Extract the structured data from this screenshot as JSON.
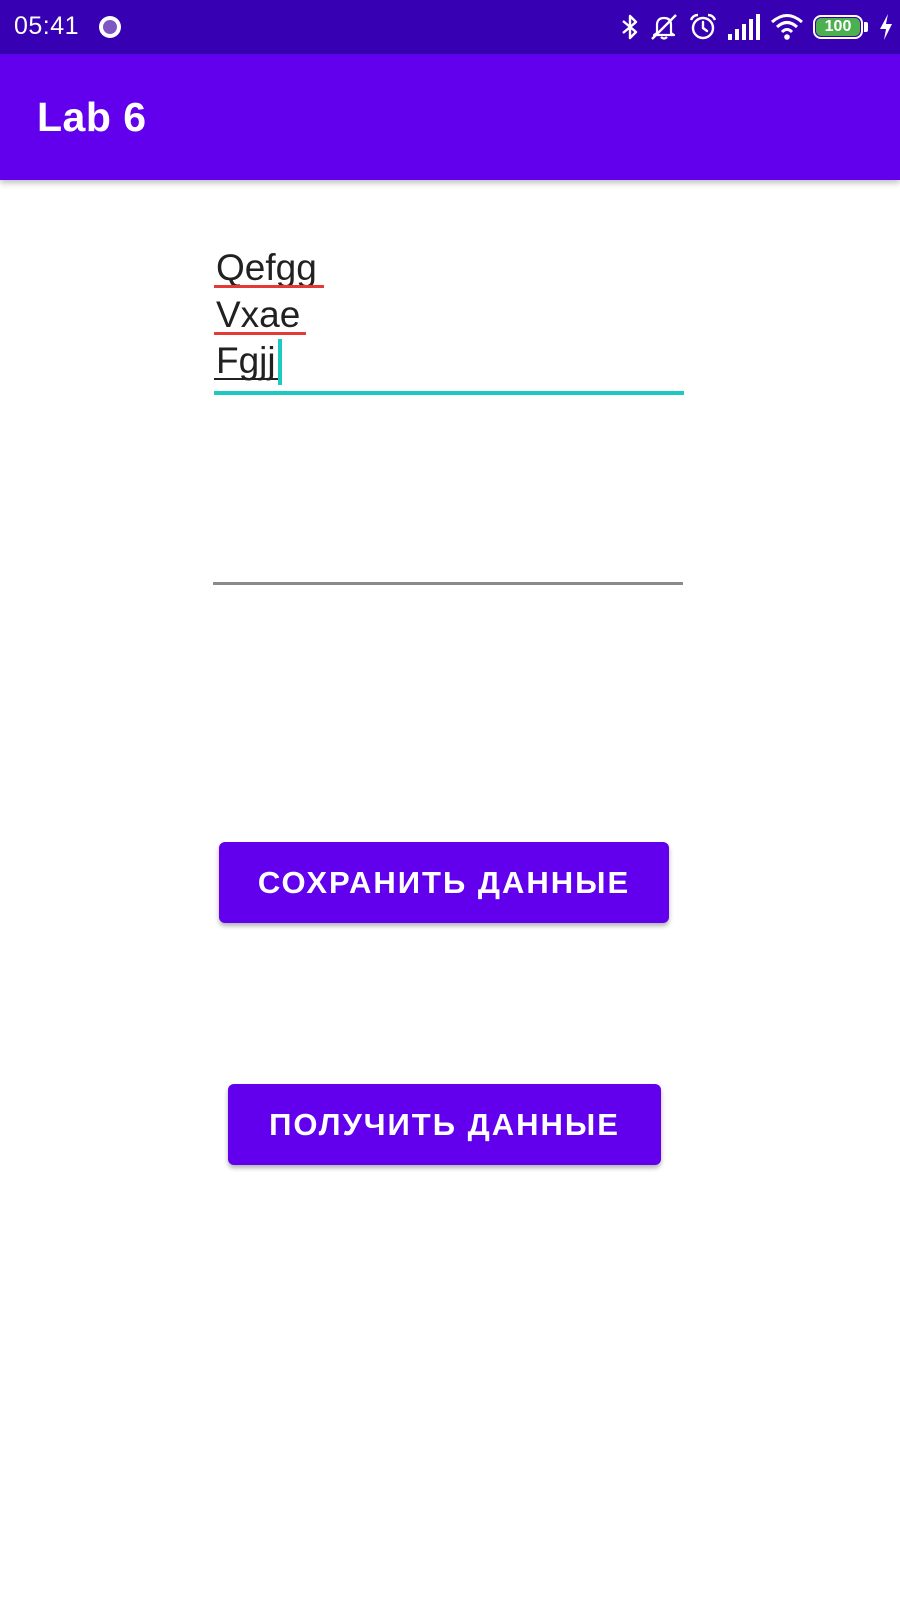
{
  "status_bar": {
    "time": "05:41",
    "battery_level": "100",
    "icons": [
      "notification-dot-icon",
      "bluetooth-icon",
      "alarm-muted-icon",
      "alarm-clock-icon",
      "signal-icon",
      "wifi-icon",
      "battery-icon",
      "charging-icon"
    ]
  },
  "app_bar": {
    "title": "Lab 6"
  },
  "input_field_1": {
    "lines": [
      "Qefgg",
      "Vxae",
      "Fgjj"
    ]
  },
  "input_field_2": {
    "value": ""
  },
  "buttons": {
    "save_label": "СОХРАНИТЬ ДАННЫЕ",
    "load_label": "ПОЛУЧИТЬ ДАННЫЕ"
  },
  "colors": {
    "status_bar": "#3700b3",
    "app_bar": "#6200ee",
    "button": "#6200ee",
    "focus_accent": "#1ec9c1",
    "spellcheck": "#e53935"
  }
}
